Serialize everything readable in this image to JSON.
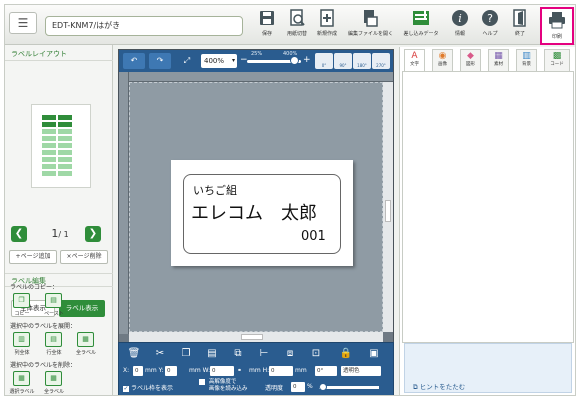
{
  "header": {
    "filename": "EDT-KNM7/はがき",
    "toolbar": [
      {
        "label": "保存",
        "icon": "save-icon"
      },
      {
        "label": "用紙切替",
        "icon": "paper-switch-icon"
      },
      {
        "label": "新規作成",
        "icon": "new-file-icon"
      },
      {
        "label": "編集ファイルを開く",
        "icon": "open-file-icon"
      },
      {
        "label": "差し込みデータ",
        "icon": "merge-data-icon"
      },
      {
        "label": "情報",
        "icon": "info-icon"
      },
      {
        "label": "ヘルプ",
        "icon": "help-icon"
      },
      {
        "label": "終了",
        "icon": "exit-icon"
      },
      {
        "label": "印刷",
        "icon": "print-icon"
      }
    ]
  },
  "sidebar": {
    "layout_title": "ラベルレイアウト",
    "page_current": "1",
    "page_total": "/ 1",
    "add_page": "ページ追加",
    "delete_page": "ページ削除",
    "edit_title": "ラベル編集",
    "show_all": "全体表示",
    "show_label": "ラベル表示",
    "copy_title": "ラベルのコピー：",
    "copy": "コピー",
    "paste": "ペースト",
    "expand_title": "選択中のラベルを展開：",
    "expand_col": "列全体",
    "expand_row": "行全体",
    "expand_all": "全ラベル",
    "delete_title": "選択中のラベルを削除：",
    "delete_selected": "選択ラベル",
    "delete_all": "全ラベル"
  },
  "canvas": {
    "zoom": "400%",
    "zoom_min": "25%",
    "zoom_max": "400%",
    "rotations": [
      "0°",
      "90°",
      "180°",
      "270°"
    ],
    "label_text": {
      "line1": "いちご組",
      "line2": "エレコム　太郎",
      "line3": "001"
    }
  },
  "bottom": {
    "x_label": "X:",
    "x_val": "0",
    "y_label": "mm Y:",
    "y_val": "0",
    "w_label": "mm W:",
    "w_val": "0",
    "h_label": "mm H:",
    "h_val": "0",
    "mm": "mm",
    "angle": "0°",
    "transparent_color": "透明色",
    "show_frame": "ラベル枠を表示",
    "hires_1": "高解像度で",
    "hires_2": "画像を読み込み",
    "opacity_label": "透明度",
    "opacity_val": "0",
    "percent": "%"
  },
  "right": {
    "tabs": [
      {
        "label": "文字",
        "glyph": "A",
        "color": "#d83b3b"
      },
      {
        "label": "画像",
        "glyph": "◉",
        "color": "#e07b2c"
      },
      {
        "label": "図形",
        "glyph": "◆",
        "color": "#d85a8a"
      },
      {
        "label": "素材",
        "glyph": "▦",
        "color": "#7a5cae"
      },
      {
        "label": "背景",
        "glyph": "▥",
        "color": "#3a86c8"
      },
      {
        "label": "コード",
        "glyph": "▩",
        "color": "#2f8d3a"
      }
    ],
    "hint": "ヒントをたたむ"
  }
}
